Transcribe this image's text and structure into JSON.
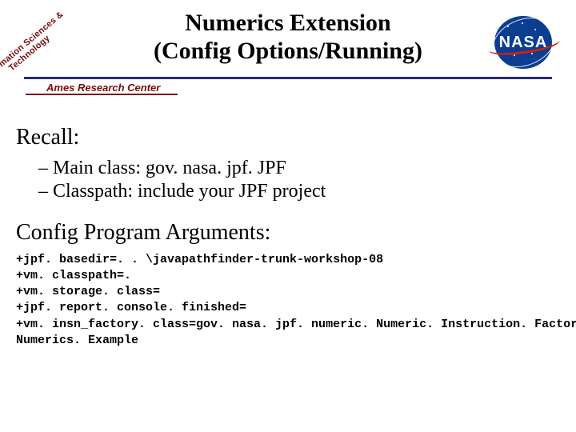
{
  "header": {
    "title_line1": "Numerics Extension",
    "title_line2": "(Config Options/Running)",
    "tech_label": "Information Sciences & Technology",
    "ames_label": "Ames Research Center",
    "nasa_text": "NASA"
  },
  "content": {
    "section1": "Recall:",
    "bullets": [
      "– Main class: gov. nasa. jpf. JPF",
      "– Classpath: include your JPF project"
    ],
    "section2": "Config Program Arguments:",
    "code_lines": [
      "+jpf. basedir=. . \\javapathfinder-trunk-workshop-08",
      "+vm. classpath=.",
      "+vm. storage. class=",
      "+jpf. report. console. finished=",
      "+vm. insn_factory. class=gov. nasa. jpf. numeric. Numeric. Instruction. Factory",
      "Numerics. Example"
    ]
  }
}
